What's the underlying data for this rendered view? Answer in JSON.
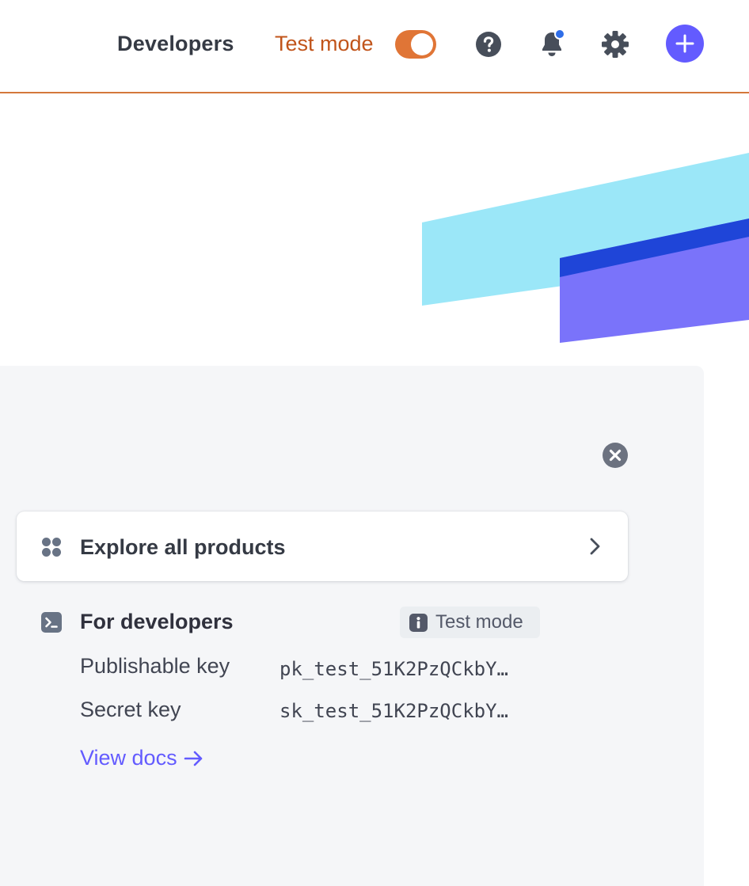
{
  "header": {
    "developers_label": "Developers",
    "test_mode_label": "Test mode",
    "test_mode_on": true,
    "icons": [
      "help-icon",
      "bell-icon",
      "gear-icon",
      "plus-icon"
    ],
    "accent_color": "#e07536",
    "notification_dot_color": "#2f6ee8",
    "create_button_color": "#635bff"
  },
  "panel": {
    "explore_label": "Explore all products",
    "developers_section": {
      "title": "For developers",
      "badge": "Test mode",
      "keys": [
        {
          "label": "Publishable key",
          "value": "pk_test_51K2PzQCkbY…"
        },
        {
          "label": "Secret key",
          "value": "sk_test_51K2PzQCkbY…"
        }
      ],
      "docs_link": "View docs"
    }
  }
}
